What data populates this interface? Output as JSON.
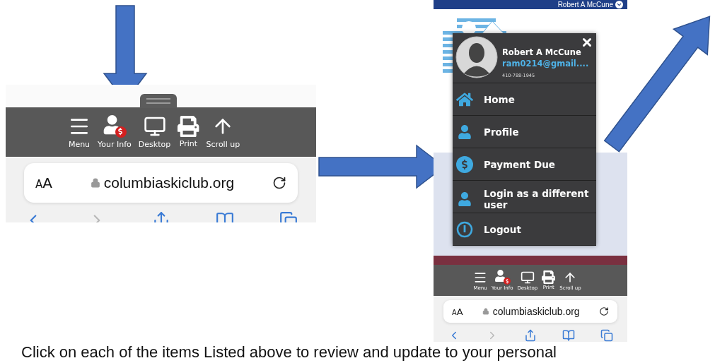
{
  "left_screenshot": {
    "toolbar": [
      {
        "label": "Menu"
      },
      {
        "label": "Your Info"
      },
      {
        "label": "Desktop"
      },
      {
        "label": "Print"
      },
      {
        "label": "Scroll up"
      }
    ],
    "address_bar": {
      "text_size": "AA",
      "url": "columbiaskiclub.org"
    }
  },
  "right_screenshot": {
    "top_bar_user": "Robert A McCune",
    "user_menu": {
      "name": "Robert A McCune",
      "email": "ram0214@gmail....",
      "phone": "410-788-1945",
      "items": [
        {
          "label": "Home"
        },
        {
          "label": "Profile"
        },
        {
          "label": "Payment Due"
        },
        {
          "label": "Login as a different user"
        },
        {
          "label": "Logout"
        }
      ]
    },
    "toolbar": [
      {
        "label": "Menu"
      },
      {
        "label": "Your Info"
      },
      {
        "label": "Desktop"
      },
      {
        "label": "Print"
      },
      {
        "label": "Scroll up"
      }
    ],
    "address_bar": {
      "text_size": "AA",
      "url": "columbiaskiclub.org"
    }
  },
  "instruction": "Click on each of the items Listed above to review and update to your personal"
}
